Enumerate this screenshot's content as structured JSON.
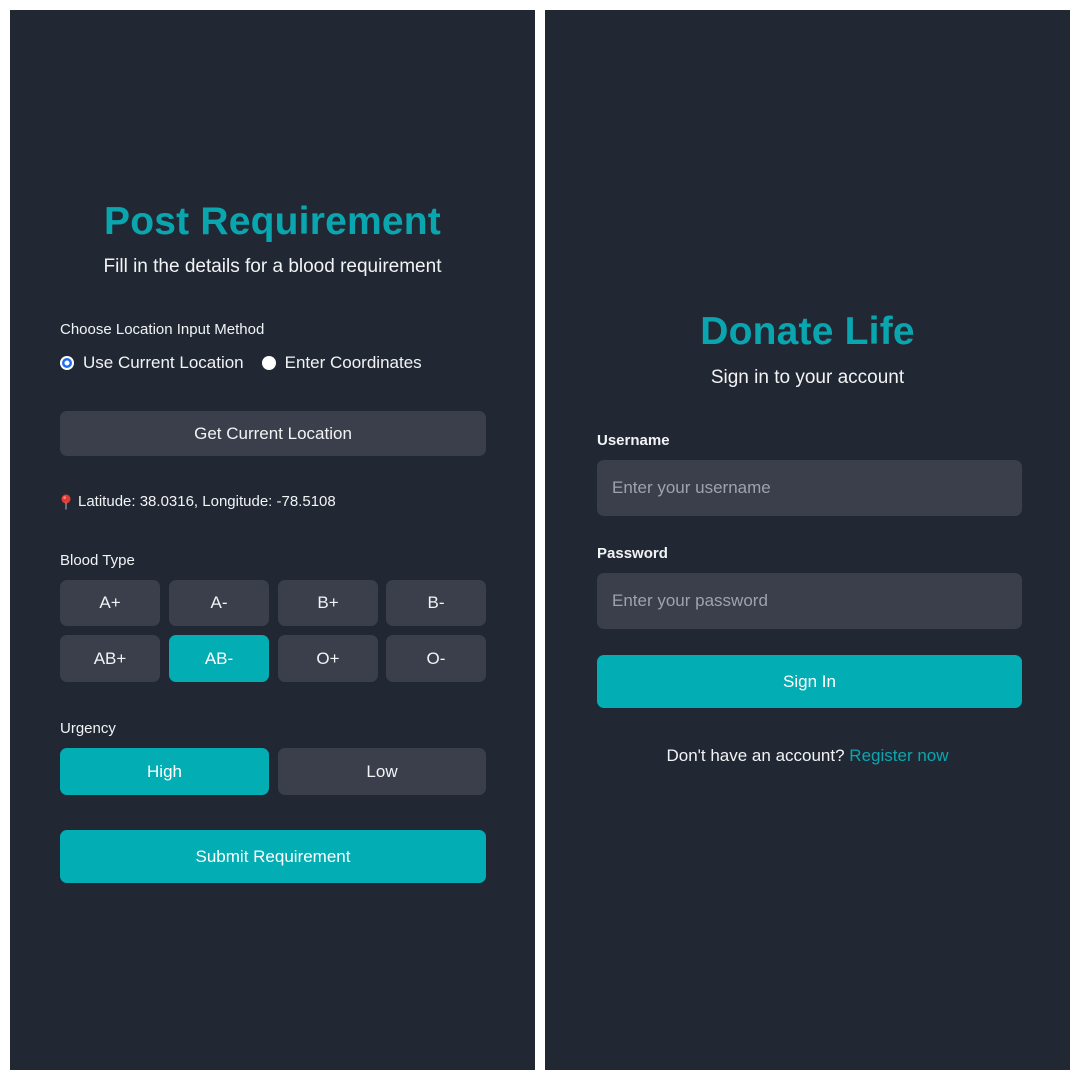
{
  "post_requirement": {
    "title": "Post Requirement",
    "subtitle": "Fill in the details for a blood requirement",
    "location_method": {
      "label": "Choose Location Input Method",
      "options": [
        "Use Current Location",
        "Enter Coordinates"
      ],
      "selected": "Use Current Location"
    },
    "get_location_button": "Get Current Location",
    "location_readout": "Latitude: 38.0316, Longitude: -78.5108",
    "blood_type": {
      "label": "Blood Type",
      "options": [
        "A+",
        "A-",
        "B+",
        "B-",
        "AB+",
        "AB-",
        "O+",
        "O-"
      ],
      "selected": "AB-"
    },
    "urgency": {
      "label": "Urgency",
      "options": [
        "High",
        "Low"
      ],
      "selected": "High"
    },
    "submit_button": "Submit Requirement"
  },
  "sign_in": {
    "title": "Donate Life",
    "subtitle": "Sign in to your account",
    "username": {
      "label": "Username",
      "placeholder": "Enter your username",
      "value": ""
    },
    "password": {
      "label": "Password",
      "placeholder": "Enter your password",
      "value": ""
    },
    "sign_in_button": "Sign In",
    "register_prompt": "Don't have an account?",
    "register_link": "Register now"
  },
  "colors": {
    "background": "#222833",
    "accent": "#02adb4",
    "control": "#3a3f4b",
    "text": "#f1f3f5",
    "radio_checked": "#1f6cf0",
    "pin": "#e53935"
  },
  "icons": {
    "location_pin": "map-pin-icon"
  }
}
